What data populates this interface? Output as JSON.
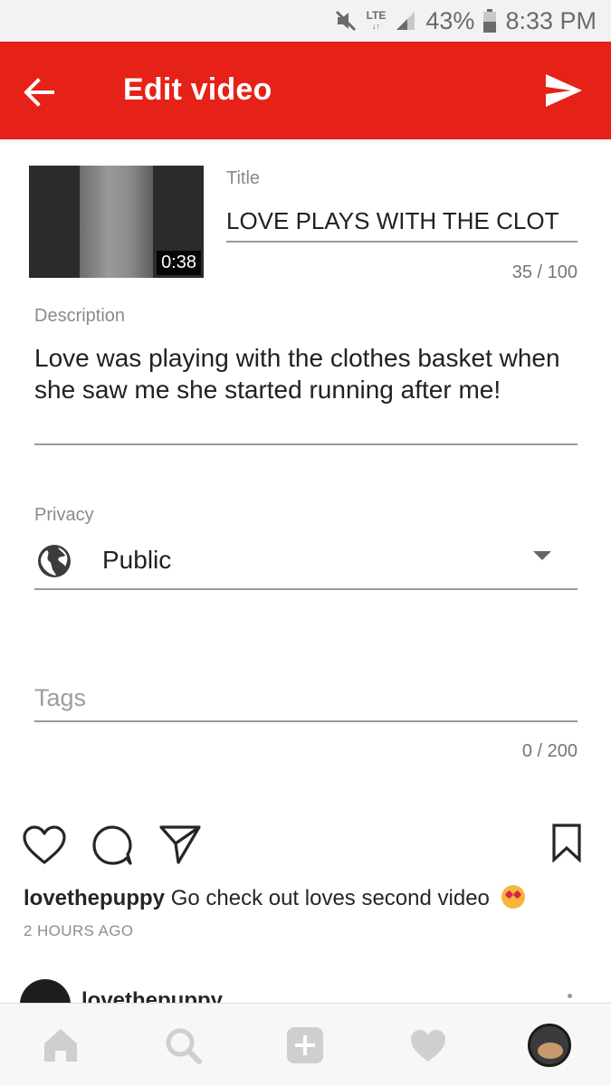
{
  "status_bar": {
    "network": "LTE",
    "battery": "43%",
    "time": "8:33 PM"
  },
  "app_bar": {
    "title": "Edit video"
  },
  "video": {
    "duration": "0:38"
  },
  "title_field": {
    "label": "Title",
    "value": "LOVE PLAYS WITH THE CLOT",
    "counter": "35 / 100"
  },
  "description_field": {
    "label": "Description",
    "value": "Love was playing with the clothes basket when she saw me she started running after me!"
  },
  "privacy_field": {
    "label": "Privacy",
    "value": "Public"
  },
  "tags_field": {
    "placeholder": "Tags",
    "counter": "0 / 200"
  },
  "post": {
    "username": "lovethepuppy",
    "caption": "Go check out loves second video",
    "time": "2 HOURS AGO"
  },
  "comment": {
    "username": "lovethepuppy"
  },
  "colors": {
    "app_bar": "#e62117",
    "status_bar": "#f2f2f2",
    "underline": "#9b9b9b",
    "bottom_nav": "#f7f7f7"
  },
  "icons": [
    "mute-icon",
    "signal-icon",
    "battery-icon",
    "back-arrow-icon",
    "send-icon",
    "globe-icon",
    "dropdown-arrow-icon",
    "heart-icon",
    "comment-icon",
    "share-icon",
    "bookmark-icon",
    "home-icon",
    "search-icon",
    "add-icon",
    "activity-icon"
  ]
}
